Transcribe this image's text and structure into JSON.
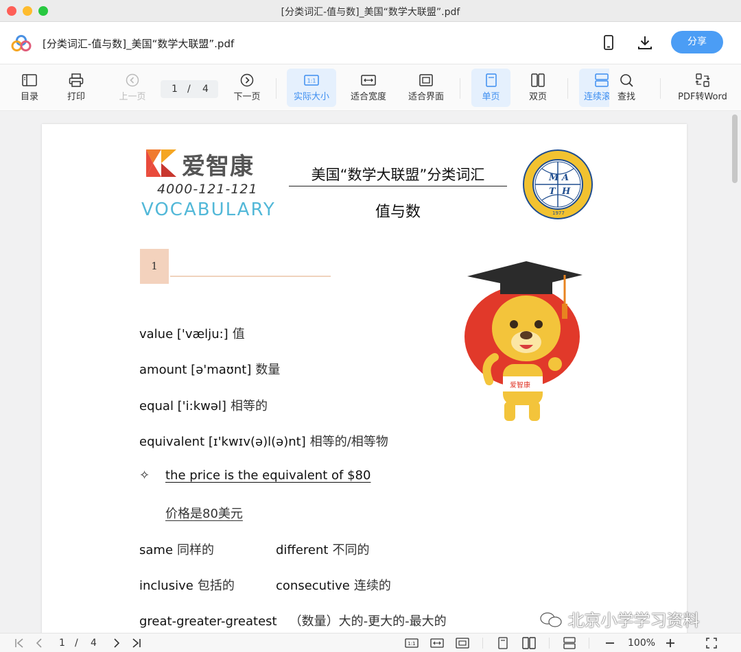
{
  "window": {
    "title": "[分类词汇-值与数]_美国“数学大联盟”.pdf"
  },
  "header": {
    "doc_title": "[分类词汇-值与数]_美国“数学大联盟”.pdf",
    "share_label": "分享"
  },
  "toolbar": {
    "toc": "目录",
    "print": "打印",
    "prev_page": "上一页",
    "current_page": "1",
    "page_sep": "/",
    "total_pages": "4",
    "next_page": "下一页",
    "actual_size": "实际大小",
    "fit_width": "适合宽度",
    "fit_window": "适合界面",
    "single_page": "单页",
    "double_page": "双页",
    "continuous": "连续滚",
    "find": "查找",
    "pdf_to_word": "PDF转Word",
    "accent_color": "#3d8ef0"
  },
  "document": {
    "brand_name": "爱智康",
    "brand_phone": "4000-121-121",
    "brand_vocab": "VOCABULARY",
    "heading": "美国“数学大联盟”分类词汇",
    "subheading": "值与数",
    "seal_text": "THE SEAL OF MATHEMATICS LEAGUE UNITED STATES OF AMERICA",
    "seal_letters": "M A T H",
    "seal_year": "1977",
    "section_number": "1",
    "mascot_badge": "爱智康",
    "vocab": [
      {
        "en": "value ['vælju:]",
        "zh": "值"
      },
      {
        "en": "amount [ə'maʊnt]",
        "zh": "数量"
      },
      {
        "en": "equal ['i:kwəl]",
        "zh": "相等的"
      },
      {
        "en": "equivalent [ɪ'kwɪv(ə)l(ə)nt]",
        "zh": "相等的/相等物"
      }
    ],
    "bullet_symbol": "✧",
    "example_en": "the price is the equivalent of $80",
    "example_zh": "价格是80美元",
    "pairs": [
      {
        "en1": "same",
        "zh1": "同样的",
        "en2": "different",
        "zh2": "不同的"
      },
      {
        "en1": "inclusive",
        "zh1": "包括的",
        "en2": "consecutive",
        "zh2": "连续的"
      }
    ],
    "last_line": {
      "en": "great-greater-greatest",
      "zh": "（数量）大的-更大的-最大的"
    }
  },
  "watermark": "北京小学学习资料",
  "statusbar": {
    "current_page": "1",
    "page_sep": "/",
    "total_pages": "4",
    "zoom": "100%"
  }
}
